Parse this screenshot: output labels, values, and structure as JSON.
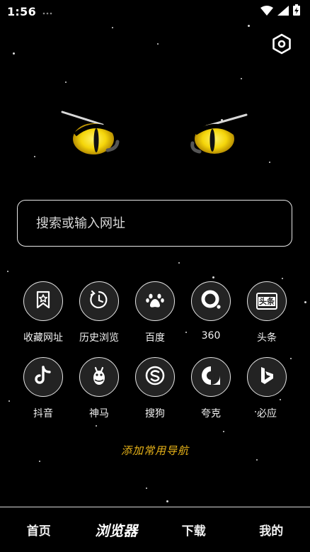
{
  "status": {
    "time": "1:56"
  },
  "search": {
    "placeholder": "搜索或输入网址"
  },
  "shortcuts_row1": [
    {
      "label": "收藏网址",
      "icon": "bookmark-star-icon"
    },
    {
      "label": "历史浏览",
      "icon": "clock-history-icon"
    },
    {
      "label": "百度",
      "icon": "baidu-paw-icon"
    },
    {
      "label": "360",
      "icon": "360-icon"
    },
    {
      "label": "头条",
      "icon": "toutiao-icon"
    }
  ],
  "shortcuts_row2": [
    {
      "label": "抖音",
      "icon": "douyin-icon"
    },
    {
      "label": "神马",
      "icon": "shenma-icon"
    },
    {
      "label": "搜狗",
      "icon": "sogou-icon"
    },
    {
      "label": "夸克",
      "icon": "quark-icon"
    },
    {
      "label": "必应",
      "icon": "bing-icon"
    }
  ],
  "toutiao_logo_text": "头条",
  "add_nav": "添加常用导航",
  "bottom_nav": {
    "home": "首页",
    "browser": "浏览器",
    "download": "下载",
    "mine": "我的"
  },
  "colors": {
    "accent": "#e8b318",
    "eye": "#f5d60a"
  }
}
